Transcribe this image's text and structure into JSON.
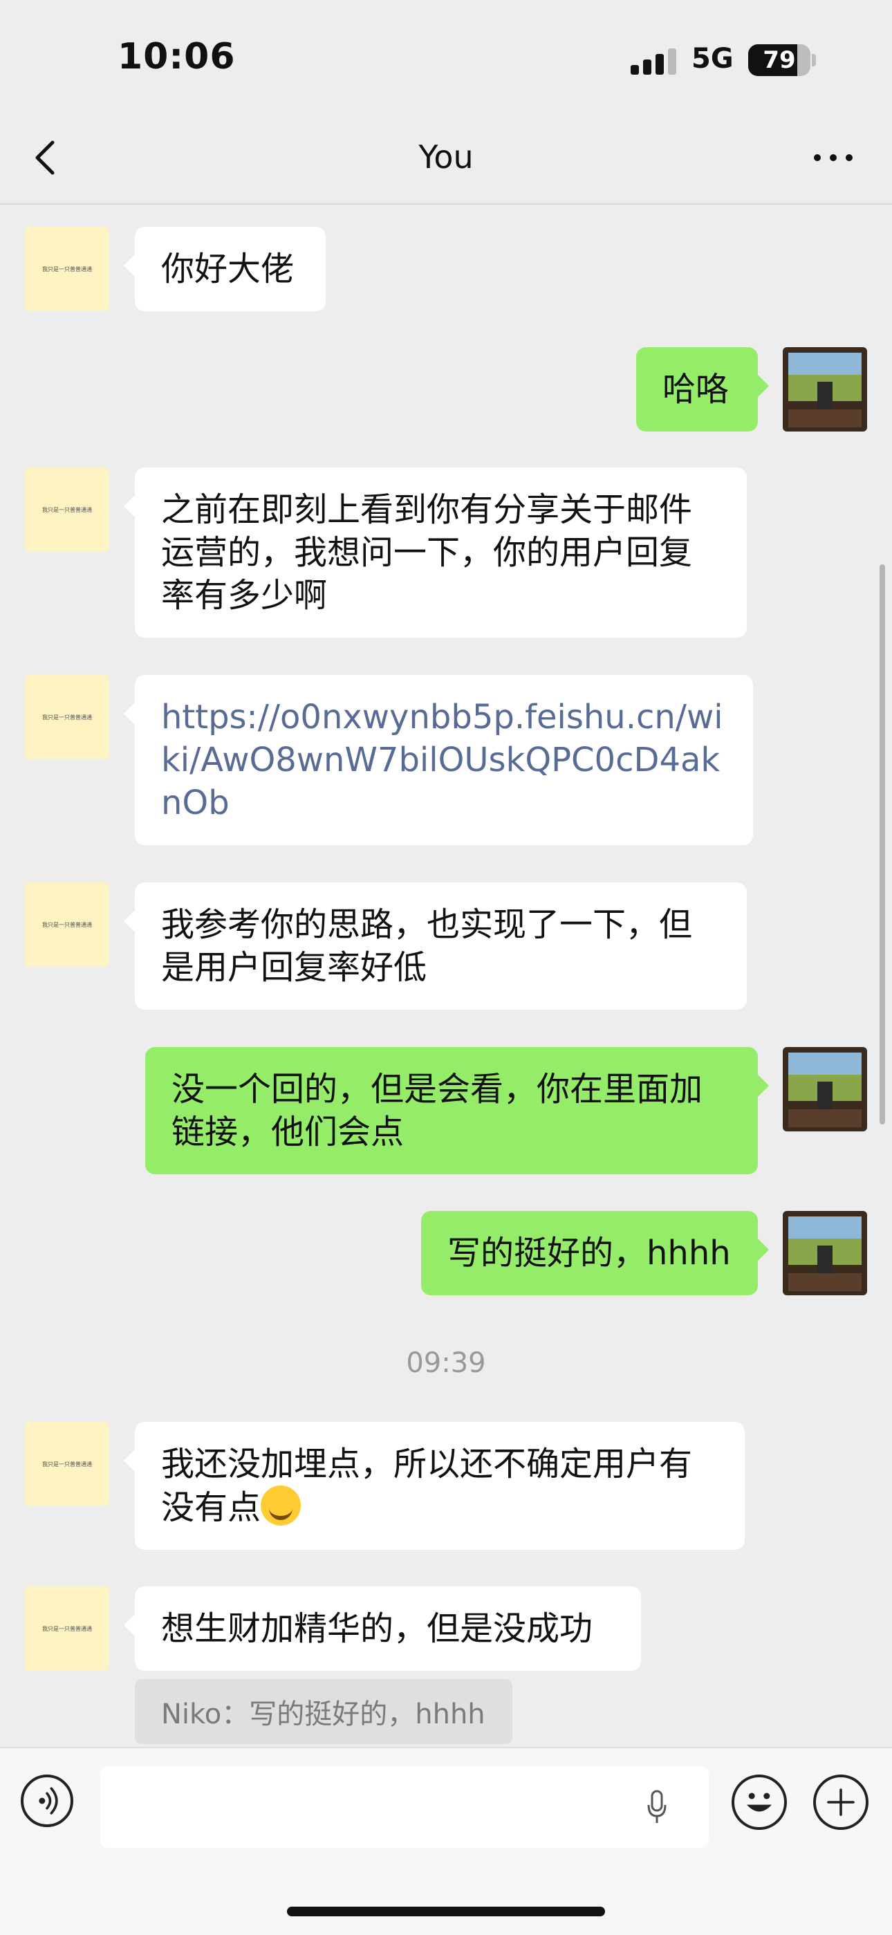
{
  "status_bar": {
    "time": "10:06",
    "network": "5G",
    "battery": "79",
    "battery_level": 0.79
  },
  "nav": {
    "title": "You"
  },
  "messages": [
    {
      "side": "in",
      "text": "你好大佬"
    },
    {
      "side": "out",
      "text": "哈咯"
    },
    {
      "side": "in",
      "text": "之前在即刻上看到你有分享关于邮件运营的，我想问一下，你的用户回复率有多少啊"
    },
    {
      "side": "in",
      "link": "https://o0nxwynbb5p.feishu.cn/wiki/AwO8wnW7bilOUskQPC0cD4aknOb"
    },
    {
      "side": "in",
      "text": "我参考你的思路，也实现了一下，但是用户回复率好低"
    },
    {
      "side": "out",
      "text": "没一个回的，但是会看，你在里面加链接，他们会点"
    },
    {
      "side": "out",
      "text": "写的挺好的，hhhh"
    },
    {
      "timestamp": "09:39"
    },
    {
      "side": "in",
      "text": "我还没加埋点，所以还不确定用户有没有点",
      "emoji": "crying-laughing"
    },
    {
      "side": "in",
      "text": "想生财加精华的，但是没成功",
      "quote": "Niko：写的挺好的，hhhh"
    }
  ],
  "avatar_left": {
    "tiny_text": "我只是一只普普通通"
  }
}
